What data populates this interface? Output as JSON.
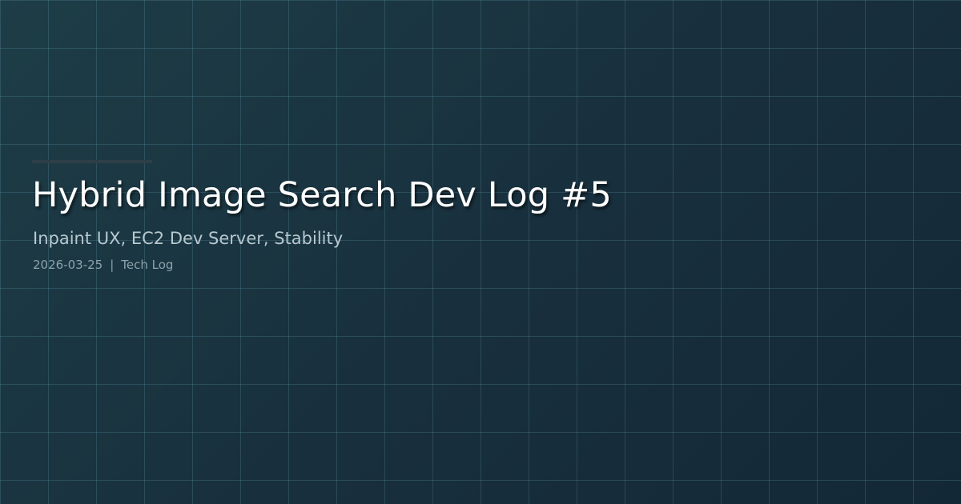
{
  "post": {
    "title": "Hybrid Image Search Dev Log #5",
    "subtitle": "Inpaint UX, EC2 Dev Server, Stability",
    "date": "2026-03-25",
    "separator": "|",
    "category": "Tech Log"
  },
  "colors": {
    "background_start": "#1d3d47",
    "background_end": "#132837",
    "grid_line": "#6eaabe",
    "title": "#ffffff",
    "subtitle": "#b7c8cf",
    "meta": "#8ea3ab",
    "accent_bar": "#2e3f48"
  }
}
